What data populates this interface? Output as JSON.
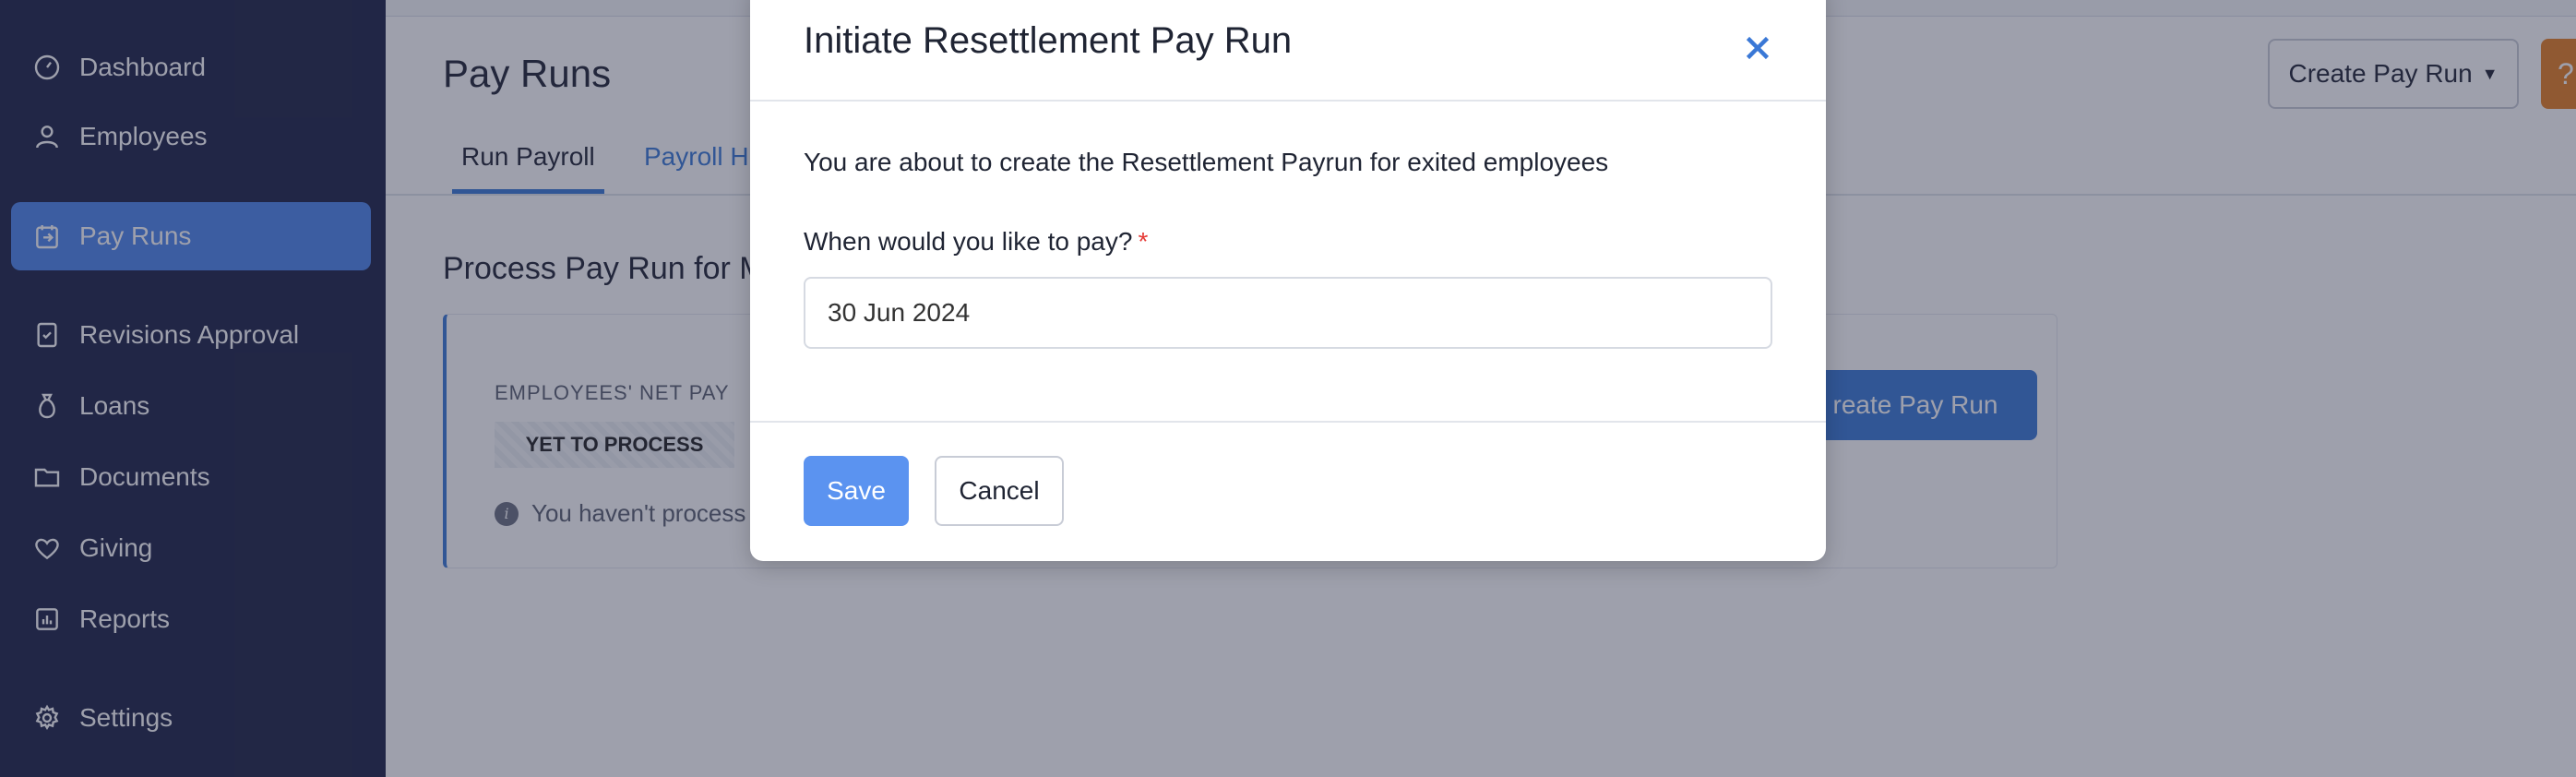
{
  "sidebar": {
    "items": [
      {
        "label": "Dashboard",
        "icon": "dashboard-icon"
      },
      {
        "label": "Employees",
        "icon": "user-icon"
      },
      {
        "label": "Pay Runs",
        "icon": "payrun-icon",
        "active": true
      },
      {
        "label": "Revisions Approval",
        "icon": "approval-icon"
      },
      {
        "label": "Loans",
        "icon": "money-bag-icon"
      },
      {
        "label": "Documents",
        "icon": "folder-icon"
      },
      {
        "label": "Giving",
        "icon": "heart-icon"
      },
      {
        "label": "Reports",
        "icon": "reports-icon"
      },
      {
        "label": "Settings",
        "icon": "gear-icon"
      }
    ]
  },
  "main": {
    "title": "Pay Runs",
    "tabs": [
      {
        "label": "Run Payroll",
        "active": true
      },
      {
        "label": "Payroll H"
      }
    ],
    "section_title": "Process Pay Run for M",
    "card": {
      "label": "EMPLOYEES' NET PAY",
      "badge": "YET TO PROCESS",
      "note": "You haven't process",
      "button_label": "reate Pay Run"
    },
    "create_dropdown_label": "Create Pay Run",
    "help_label": "?"
  },
  "modal": {
    "title": "Initiate Resettlement Pay Run",
    "description": "You are about to create the Resettlement Payrun for exited employees",
    "field_label": "When would you like to pay?",
    "required_mark": "*",
    "date_value": "30 Jun 2024",
    "save_label": "Save",
    "cancel_label": "Cancel"
  },
  "colors": {
    "sidebar_bg": "#1d2245",
    "accent": "#3a78d6",
    "active_nav": "#4d86ec",
    "help_button": "#e67e22",
    "required": "#e53935"
  }
}
